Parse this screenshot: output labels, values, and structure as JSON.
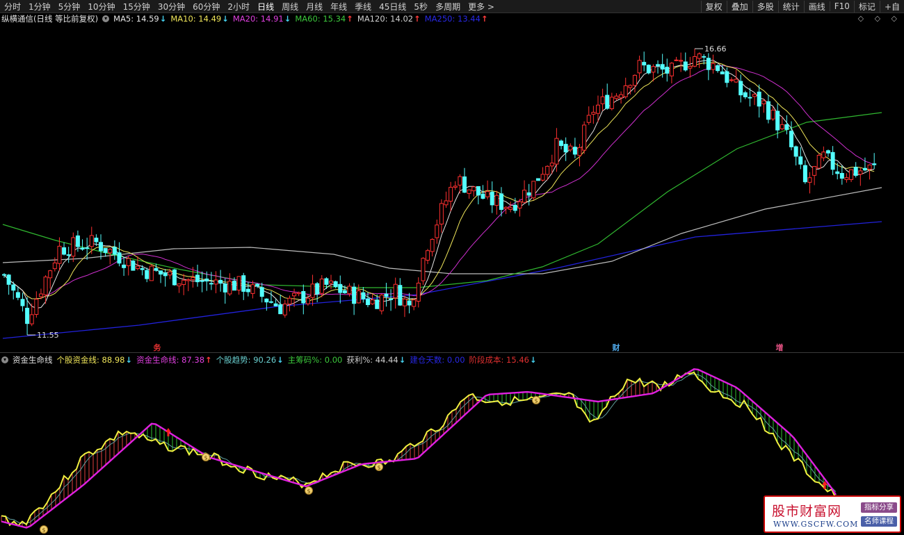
{
  "toolbar": {
    "periods": [
      "分时",
      "1分钟",
      "5分钟",
      "10分钟",
      "15分钟",
      "30分钟",
      "60分钟",
      "2小时",
      "日线",
      "周线",
      "月线",
      "年线",
      "季线",
      "45日线",
      "5秒",
      "多周期",
      "更多 >"
    ],
    "active_period": "日线",
    "right_buttons": [
      "复权",
      "叠加",
      "多股",
      "统计",
      "画线",
      "F10",
      "标记",
      "+自"
    ]
  },
  "main_legend": {
    "title": "纵横通信(日线 等比前复权)",
    "items": [
      {
        "label": "MA5: 14.59",
        "arrow": "↓",
        "color": "#e6e6e6"
      },
      {
        "label": "MA10: 14.49",
        "arrow": "↓",
        "color": "#f0e65a"
      },
      {
        "label": "MA20: 14.91",
        "arrow": "↓",
        "color": "#e040e0"
      },
      {
        "label": "MA60: 15.34",
        "arrow": "↑",
        "color": "#3cc83c"
      },
      {
        "label": "MA120: 14.02",
        "arrow": "↑",
        "color": "#cfcfcf"
      },
      {
        "label": "MA250: 13.44",
        "arrow": "↑",
        "color": "#2828e6"
      }
    ],
    "arrow_colors": {
      "up": "#ff3c3c",
      "down": "#46d2f0"
    },
    "corner_icons": "◇ ◇ ◇"
  },
  "main_chart": {
    "high_label": "16.66",
    "low_label": "11.55",
    "markers": [
      {
        "text": "务",
        "color": "#e03030"
      },
      {
        "text": "财",
        "color": "#4fa8e8"
      },
      {
        "text": "增",
        "color": "#e05080"
      }
    ],
    "colors": {
      "up": "#ff3030",
      "down": "#54ffff",
      "ma5": "#e6e6e6",
      "ma10": "#f0e65a",
      "ma20": "#d030d0",
      "ma60": "#30b830",
      "ma120": "#bdbdbd",
      "ma250": "#2222dd"
    }
  },
  "indicator_legend": {
    "title": "资金生命线",
    "items": [
      {
        "label": "个股资金线: 88.98",
        "arrow": "↓",
        "color": "#f0e65a"
      },
      {
        "label": "资金生命线: 87.38",
        "arrow": "↑",
        "color": "#e040e0"
      },
      {
        "label": "个股趋势: 90.26",
        "arrow": "↓",
        "color": "#6ad0d0"
      },
      {
        "label": "主筹码%: 0.00",
        "arrow": "",
        "color": "#3cc83c"
      },
      {
        "label": "获利%: 44.44",
        "arrow": "↓",
        "color": "#cfcfcf"
      },
      {
        "label": "建仓天数: 0.00",
        "arrow": "",
        "color": "#2828e6"
      },
      {
        "label": "阶段成本: 15.46",
        "arrow": "↓",
        "color": "#e03030"
      }
    ]
  },
  "indicator_chart": {
    "colors": {
      "fund": "#f0f040",
      "life": "#e020e0",
      "trend": "#60a0a0",
      "fill_up": "#e04040",
      "fill_down": "#30c030"
    },
    "money_bag": "$"
  },
  "watermark": {
    "title": "股市财富网",
    "url": "WWW.GSCFW.COM",
    "tag1": "指标分享",
    "tag2": "名师课程"
  }
}
